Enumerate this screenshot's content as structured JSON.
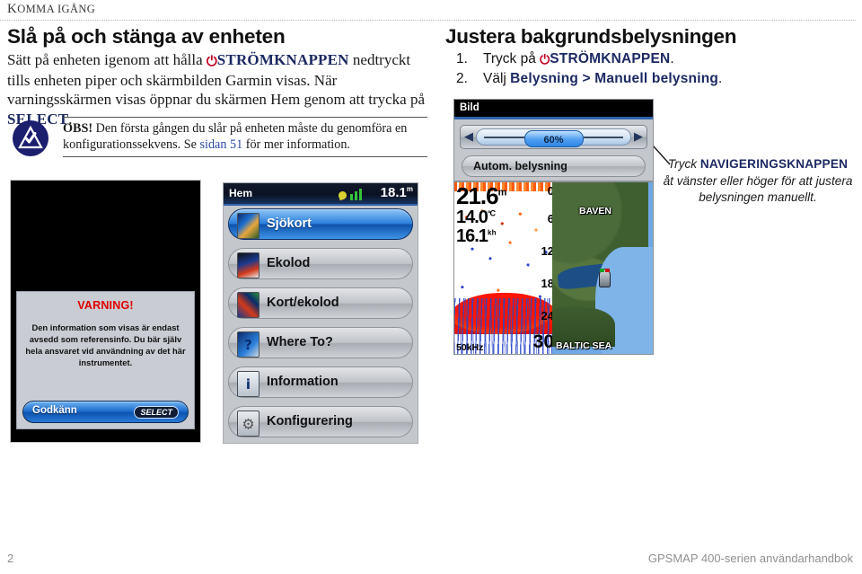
{
  "running_header": {
    "cap": "K",
    "rest": "OMMA IGÅNG",
    "full": "Komma igång"
  },
  "left": {
    "title": "Slå på och stänga av enheten",
    "para_1": "Sätt på enheten igenom att hålla ",
    "power_key": "STRÖMKNAPPEN",
    "para_2": " nedtryckt tills enheten piper och skärmbilden Garmin visas. När varningsskärmen visas öppnar du skärmen Hem genom att trycka på ",
    "select_key": "SELECT",
    "para_3": ".",
    "note": {
      "label": "OBS!",
      "text_1": " Den första gången du slår på enheten måste du genomföra en konfigurationssekvens. Se ",
      "xref": "sidan 51",
      "text_2": " för mer information."
    }
  },
  "right": {
    "title": "Justera bakgrundsbelysningen",
    "steps": [
      {
        "num": "1.",
        "pre": "Tryck på ",
        "bold": "STRÖMKNAPPEN",
        "post": ".",
        "has_power_icon": true
      },
      {
        "num": "2.",
        "pre": "Välj ",
        "bold": "Belysning > Manuell belysning",
        "post": ".",
        "has_power_icon": false
      }
    ],
    "caption": {
      "pre": "Tryck ",
      "bold": "NAVIGERINGSKNAPPEN",
      "post": " åt vänster eller höger för att justera belysningen manuellt."
    }
  },
  "warning_screen": {
    "title": "VARNING!",
    "text": "Den information som visas är endast avsedd som referensinfo. Du bär själv hela ansvaret vid användning av det här instrumentet.",
    "button_label": "Godkänn",
    "button_key": "SELECT"
  },
  "home_screen": {
    "bar_title": "Hem",
    "depth_value": "18.1",
    "depth_unit": "m",
    "items": [
      {
        "label": "Sjökort",
        "icon": "chart-icon",
        "selected": true
      },
      {
        "label": "Ekolod",
        "icon": "sonar-icon",
        "selected": false
      },
      {
        "label": "Kort/ekolod",
        "icon": "chart-sonar-icon",
        "selected": false
      },
      {
        "label": "Where To?",
        "icon": "magnifier-icon",
        "selected": false
      },
      {
        "label": "Information",
        "icon": "info-icon",
        "selected": false
      },
      {
        "label": "Konfigurering",
        "icon": "gear-icon",
        "selected": false
      }
    ]
  },
  "backlight_dialog": {
    "bar_title": "Bild",
    "slider_value": "60%",
    "auto_button": "Autom. belysning",
    "arrow_left": "◀",
    "arrow_right": "▶"
  },
  "combo_screen": {
    "sonar": {
      "depth": "21.6",
      "depth_unit": "m",
      "temp": "14.0",
      "temp_unit": "°C",
      "speed": "16.1",
      "speed_unit": "k h",
      "frequency": "50kHz",
      "depth_ticks": [
        "0",
        "6",
        "12",
        "18",
        "24",
        "30"
      ]
    },
    "chart": {
      "label_lake": "BAVEN",
      "label_sea": "BALTIC SEA"
    }
  },
  "footer": {
    "page_number": "2",
    "manual_title": "GPSMAP 400-serien användarhandbok"
  },
  "colors": {
    "keyword_blue": "#1c2a63",
    "xref_blue": "#2d4ea8",
    "power_red": "#c00020",
    "warning_red": "#e00000",
    "footer_gray": "#8f8f8f",
    "garmin_navy": "#1b1f6e"
  }
}
